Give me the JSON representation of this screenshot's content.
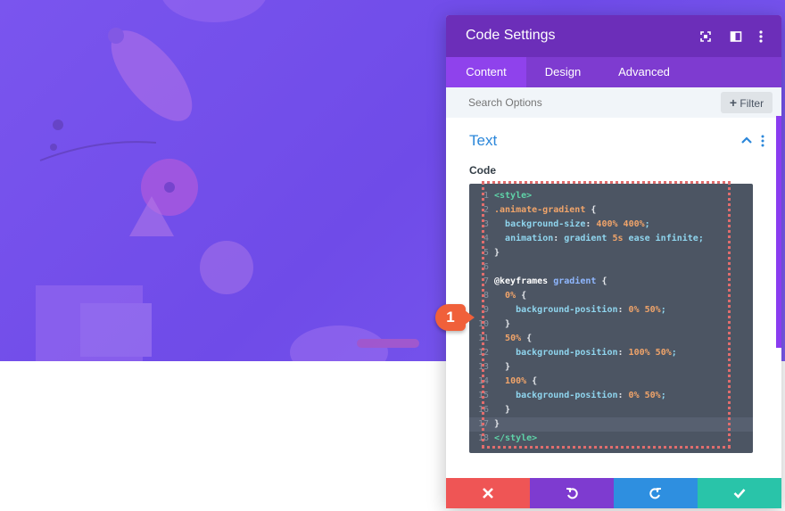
{
  "panel": {
    "title": "Code Settings",
    "header_icons": [
      "expand-icon",
      "split-view-icon",
      "more-icon"
    ]
  },
  "tabs": [
    {
      "label": "Content",
      "active": true
    },
    {
      "label": "Design",
      "active": false
    },
    {
      "label": "Advanced",
      "active": false
    }
  ],
  "search": {
    "placeholder": "Search Options"
  },
  "filter": {
    "label": "Filter"
  },
  "section": {
    "title": "Text"
  },
  "field": {
    "label": "Code"
  },
  "code_lines": [
    {
      "n": "1",
      "text": "<style>"
    },
    {
      "n": "2",
      "text": ".animate-gradient {"
    },
    {
      "n": "3",
      "text": "  background-size: 400% 400%;"
    },
    {
      "n": "4",
      "text": "  animation: gradient 5s ease infinite;"
    },
    {
      "n": "5",
      "text": "}"
    },
    {
      "n": "6",
      "text": ""
    },
    {
      "n": "7",
      "text": "@keyframes gradient {"
    },
    {
      "n": "8",
      "text": "  0% {"
    },
    {
      "n": "9",
      "text": "    background-position: 0% 50%;"
    },
    {
      "n": "10",
      "text": "  }"
    },
    {
      "n": "11",
      "text": "  50% {"
    },
    {
      "n": "12",
      "text": "    background-position: 100% 50%;"
    },
    {
      "n": "13",
      "text": "  }"
    },
    {
      "n": "14",
      "text": "  100% {"
    },
    {
      "n": "15",
      "text": "    background-position: 0% 50%;"
    },
    {
      "n": "16",
      "text": "  }"
    },
    {
      "n": "17",
      "text": "}"
    },
    {
      "n": "18",
      "text": "</style>"
    }
  ],
  "highlighted_line": "17",
  "annotation": {
    "label": "1"
  },
  "footer_buttons": [
    {
      "name": "discard-button",
      "icon": "close-icon",
      "color": "#ef5555"
    },
    {
      "name": "undo-button",
      "icon": "undo-icon",
      "color": "#7e3bd0"
    },
    {
      "name": "redo-button",
      "icon": "redo-icon",
      "color": "#2e8fe0"
    },
    {
      "name": "save-button",
      "icon": "check-icon",
      "color": "#29c4a9"
    }
  ],
  "colors": {
    "header": "#6c2eb9",
    "tabs": "#7e3bd0",
    "active_tab": "#8f42ec",
    "section_title": "#2b87da",
    "code_bg": "#4c5563"
  }
}
